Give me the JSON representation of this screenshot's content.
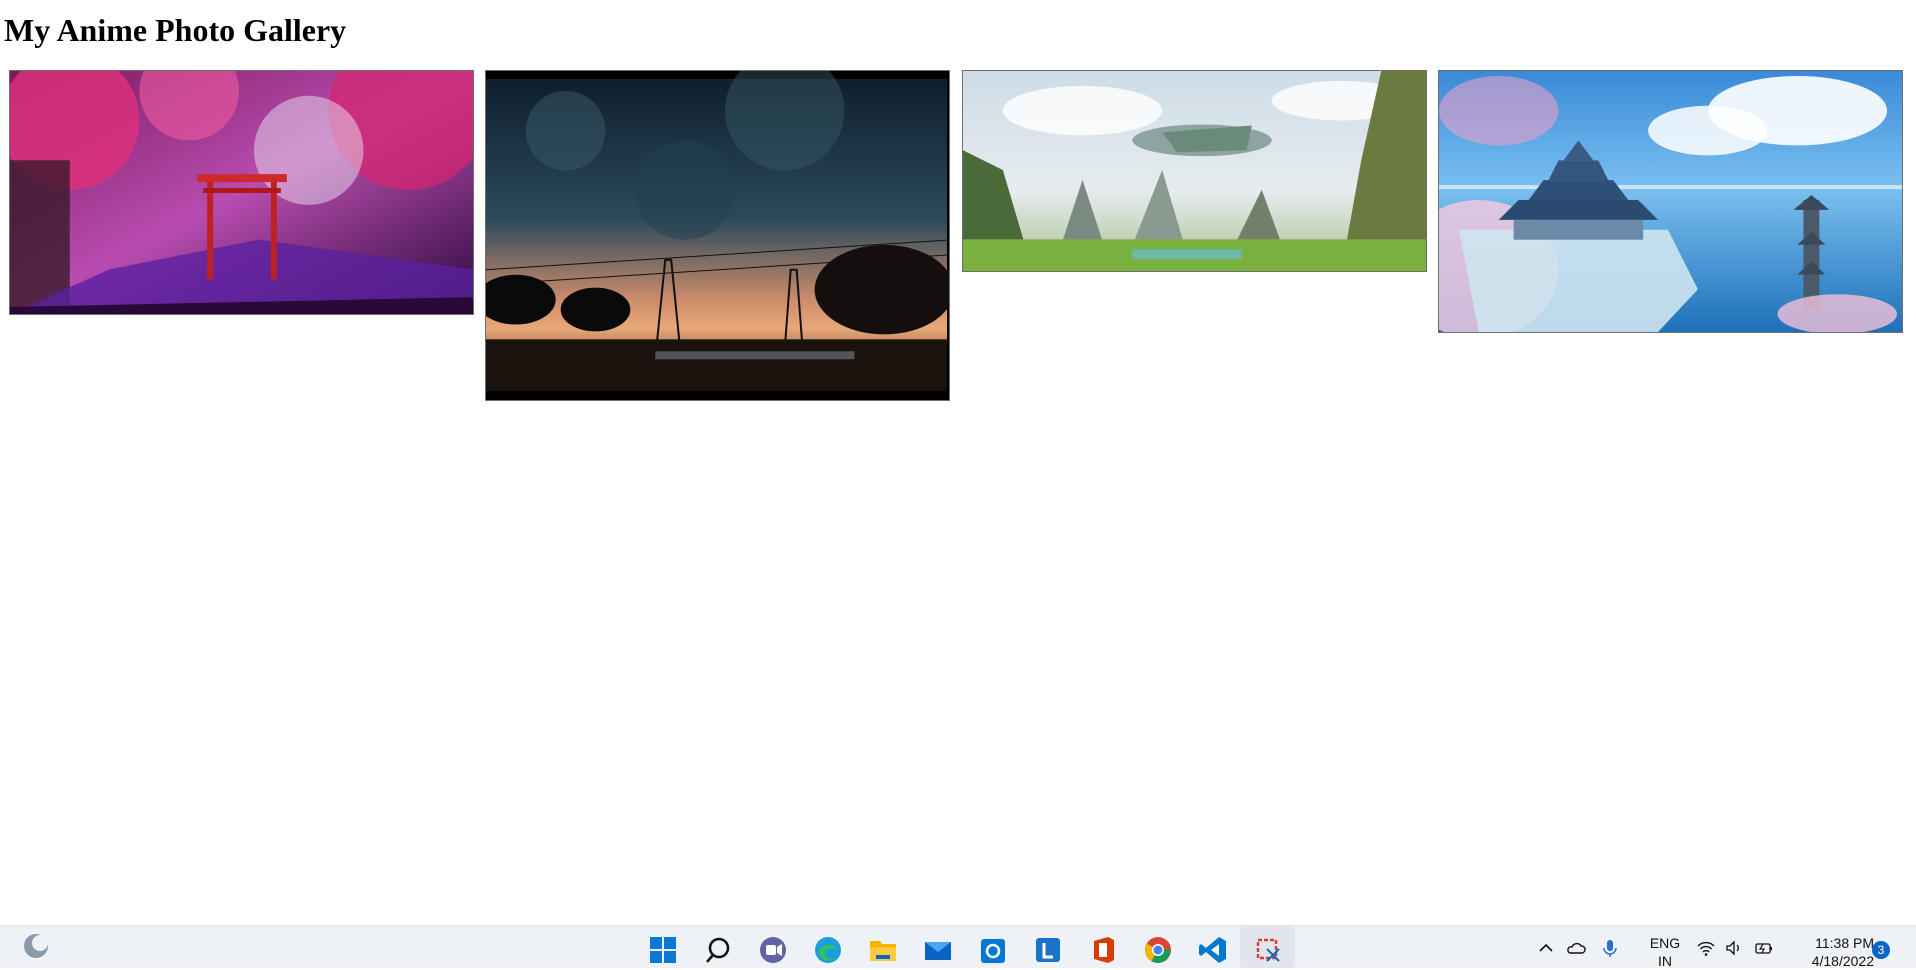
{
  "page": {
    "title": "My Anime Photo Gallery"
  },
  "gallery": {
    "photos": [
      {
        "name": "cherry-blossom-torii-photo"
      },
      {
        "name": "sunset-power-lines-photo"
      },
      {
        "name": "sky-whale-cliffs-photo"
      },
      {
        "name": "floating-castle-photo"
      }
    ]
  },
  "taskbar": {
    "apps": [
      {
        "icon": "windows-start-icon"
      },
      {
        "icon": "search-icon"
      },
      {
        "icon": "teams-chat-icon"
      },
      {
        "icon": "edge-browser-icon"
      },
      {
        "icon": "file-explorer-icon"
      },
      {
        "icon": "mail-icon"
      },
      {
        "icon": "store-icon"
      },
      {
        "icon": "l-app-icon"
      },
      {
        "icon": "office-icon"
      },
      {
        "icon": "chrome-icon"
      },
      {
        "icon": "vscode-icon"
      },
      {
        "icon": "snipping-tool-icon"
      }
    ],
    "language_line1": "ENG",
    "language_line2": "IN",
    "time": "11:38 PM",
    "date": "4/18/2022",
    "notification_count": "3"
  }
}
